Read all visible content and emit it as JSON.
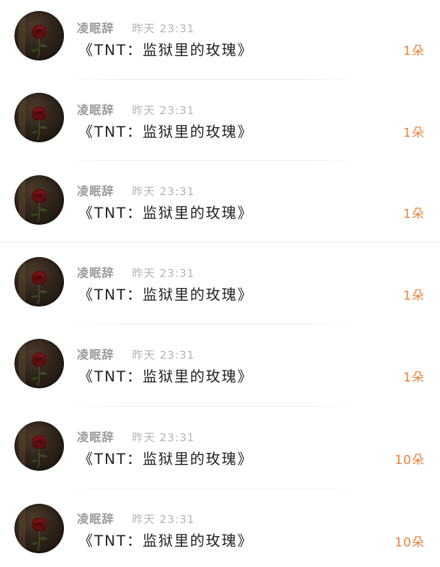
{
  "feed": {
    "items": [
      {
        "username": "凌眠辞",
        "time": "昨天 23:31",
        "title": "《TNT：监狱里的玫瑰》",
        "count": "1朵",
        "avatar_icon": "rose-avatar-icon"
      },
      {
        "username": "凌眠辞",
        "time": "昨天 23:31",
        "title": "《TNT：监狱里的玫瑰》",
        "count": "1朵",
        "avatar_icon": "rose-avatar-icon"
      },
      {
        "username": "凌眠辞",
        "time": "昨天 23:31",
        "title": "《TNT：监狱里的玫瑰》",
        "count": "1朵",
        "avatar_icon": "rose-avatar-icon"
      },
      {
        "username": "凌眠辞",
        "time": "昨天 23:31",
        "title": "《TNT：监狱里的玫瑰》",
        "count": "1朵",
        "avatar_icon": "rose-avatar-icon"
      },
      {
        "username": "凌眠辞",
        "time": "昨天 23:31",
        "title": "《TNT：监狱里的玫瑰》",
        "count": "1朵",
        "avatar_icon": "rose-avatar-icon"
      },
      {
        "username": "凌眠辞",
        "time": "昨天 23:31",
        "title": "《TNT：监狱里的玫瑰》",
        "count": "10朵",
        "avatar_icon": "rose-avatar-icon"
      },
      {
        "username": "凌眠辞",
        "time": "昨天 23:31",
        "title": "《TNT：监狱里的玫瑰》",
        "count": "10朵",
        "avatar_icon": "rose-avatar-icon"
      }
    ]
  },
  "colors": {
    "count_accent": "#e8823a",
    "username": "#9a9a9a",
    "time": "#b4b4b4",
    "title": "#222222"
  }
}
